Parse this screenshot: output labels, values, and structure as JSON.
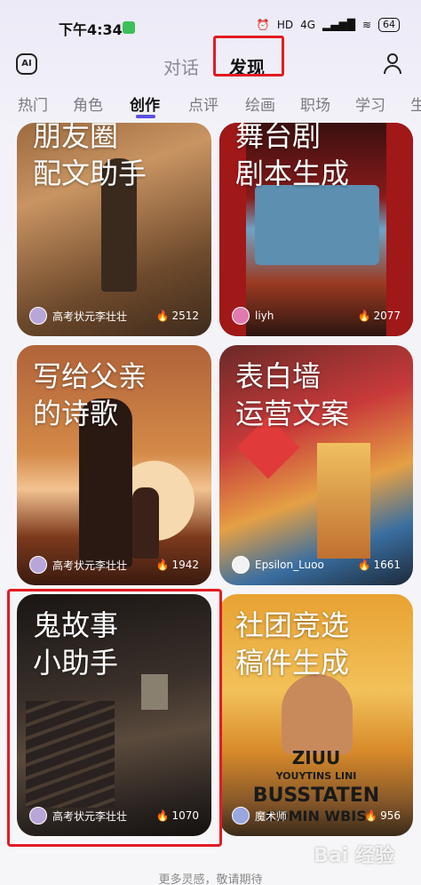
{
  "status_bar": {
    "time": "下午4:34",
    "network": "4G",
    "hd": "HD",
    "battery": "64"
  },
  "header": {
    "tab_dialog": "对话",
    "tab_discover": "发现",
    "logo": "AI"
  },
  "categories": [
    "热门",
    "角色",
    "创作",
    "点评",
    "绘画",
    "职场",
    "学习",
    "生"
  ],
  "active_category": "创作",
  "cards": [
    {
      "title": "朋友圈\n配文助手",
      "author": "高考状元李壮壮",
      "count": "2512"
    },
    {
      "title": "舞台剧\n剧本生成",
      "author": "liyh",
      "count": "2077"
    },
    {
      "title": "写给父亲\n的诗歌",
      "author": "高考状元李壮壮",
      "count": "1942"
    },
    {
      "title": "表白墙\n运营文案",
      "author": "Epsilon_Luoo",
      "count": "1661"
    },
    {
      "title": "鬼故事\n小助手",
      "author": "高考状元李壮壮",
      "count": "1070"
    },
    {
      "title": "社团竞选\n稿件生成",
      "author": "魔术师",
      "count": "956"
    }
  ],
  "poster": {
    "line1": "ZIUU",
    "line2": "YOUYTINS LINI",
    "line3": "BUSSTATEN",
    "line4": "COMIN WBIS"
  },
  "footer_note": "更多灵感，敬请期待",
  "watermark": "Bai 经验",
  "colors": {
    "accent": "#5a4fe0",
    "highlight": "#e31b23"
  }
}
